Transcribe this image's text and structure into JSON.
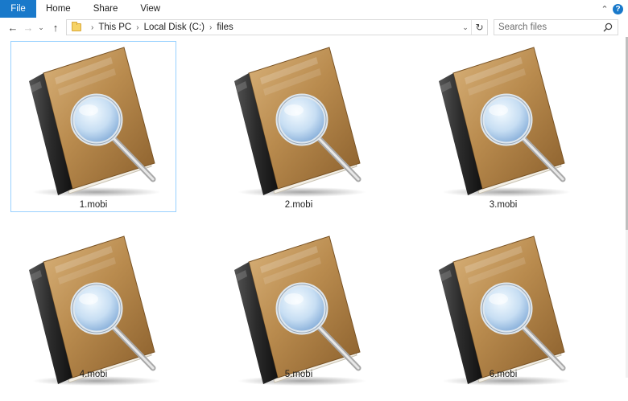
{
  "ribbon": {
    "tabs": [
      {
        "label": "File"
      },
      {
        "label": "Home"
      },
      {
        "label": "Share"
      },
      {
        "label": "View"
      }
    ],
    "help_label": "?"
  },
  "address": {
    "crumbs": [
      "This PC",
      "Local Disk (C:)",
      "files"
    ]
  },
  "search": {
    "placeholder": "Search files"
  },
  "files": [
    {
      "name": "1.mobi",
      "selected": true
    },
    {
      "name": "2.mobi",
      "selected": false
    },
    {
      "name": "3.mobi",
      "selected": false
    },
    {
      "name": "4.mobi",
      "selected": false
    },
    {
      "name": "5.mobi",
      "selected": false
    },
    {
      "name": "6.mobi",
      "selected": false
    }
  ],
  "colors": {
    "accent": "#1979ca",
    "selection_border": "#99d1ff",
    "book_cover": "#b98b4e",
    "book_spine": "#2b2b2b"
  },
  "icons": {
    "file_type": "ebook-magnifier-icon",
    "address_folder": "folder-icon",
    "search": "search-icon"
  }
}
